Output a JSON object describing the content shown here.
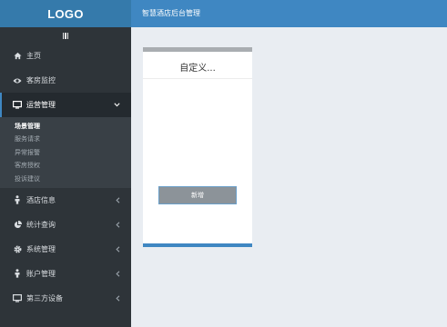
{
  "header": {
    "logo": "LOGO",
    "title": "智慧酒店后台管理"
  },
  "sidebar": {
    "items": [
      {
        "label": "主页",
        "icon": "home-icon"
      },
      {
        "label": "客房监控",
        "icon": "eye-icon"
      },
      {
        "label": "运营管理",
        "icon": "monitor-icon",
        "expanded": true,
        "children": [
          "场景管理",
          "服务请求",
          "异常报警",
          "客房授权",
          "投诉建议"
        ],
        "current": "场景管理"
      },
      {
        "label": "酒店信息",
        "icon": "person-icon"
      },
      {
        "label": "统计查询",
        "icon": "pie-chart-icon"
      },
      {
        "label": "系统管理",
        "icon": "gear-icon"
      },
      {
        "label": "账户管理",
        "icon": "person-icon"
      },
      {
        "label": "第三方设备",
        "icon": "monitor-icon"
      }
    ]
  },
  "card": {
    "title": "自定义...",
    "add_button": "新增"
  },
  "colors": {
    "topbar": "#3f87c2",
    "sidebar": "#2e3439",
    "accent": "#3f87c2"
  }
}
